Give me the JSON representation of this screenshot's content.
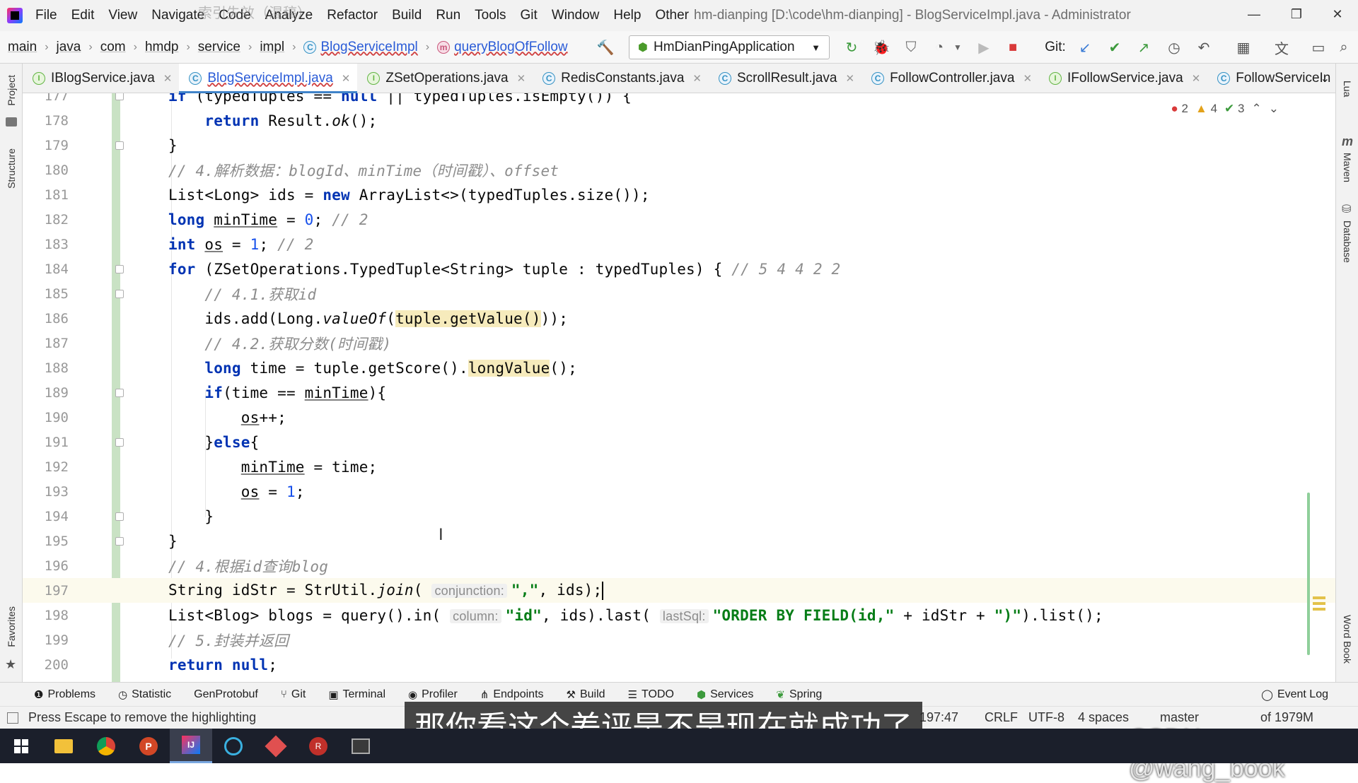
{
  "titlebar": {
    "menu": [
      "File",
      "Edit",
      "View",
      "Navigate",
      "Code",
      "Analyze",
      "Refactor",
      "Build",
      "Run",
      "Tools",
      "Git",
      "Window",
      "Help",
      "Other"
    ],
    "title": "hm-dianping [D:\\code\\hm-dianping] - BlogServiceImpl.java - Administrator",
    "watermark": "索引失效（混稿）"
  },
  "breadcrumb": [
    "main",
    "java",
    "com",
    "hmdp",
    "service",
    "impl",
    "BlogServiceImpl",
    "queryBlogOfFollow"
  ],
  "run_config": "HmDianPingApplication",
  "git_label": "Git:",
  "tabs": [
    {
      "name": "IBlogService.java",
      "kind": "I",
      "active": false
    },
    {
      "name": "BlogServiceImpl.java",
      "kind": "C",
      "active": true
    },
    {
      "name": "ZSetOperations.java",
      "kind": "I",
      "active": false
    },
    {
      "name": "RedisConstants.java",
      "kind": "C",
      "active": false
    },
    {
      "name": "ScrollResult.java",
      "kind": "C",
      "active": false
    },
    {
      "name": "FollowController.java",
      "kind": "C",
      "active": false
    },
    {
      "name": "IFollowService.java",
      "kind": "I",
      "active": false
    },
    {
      "name": "FollowServiceIn",
      "kind": "C",
      "active": false
    }
  ],
  "inspections": {
    "errors": "2",
    "warnings": "4",
    "weak": "3"
  },
  "left_tools": [
    "Project",
    "Structure",
    "Favorites"
  ],
  "right_tools": [
    "Lua",
    "Maven",
    "Database",
    "Word Book"
  ],
  "line_numbers": [
    "177",
    "178",
    "179",
    "180",
    "181",
    "182",
    "183",
    "184",
    "185",
    "186",
    "187",
    "188",
    "189",
    "190",
    "191",
    "192",
    "193",
    "194",
    "195",
    "196",
    "197",
    "198",
    "199",
    "200"
  ],
  "hints": {
    "conjunction": "conjunction:",
    "column": "column:",
    "lastSql": "lastSql:"
  },
  "tool_windows": [
    "Problems",
    "Statistic",
    "GenProtobuf",
    "Git",
    "Terminal",
    "Profiler",
    "Endpoints",
    "Build",
    "TODO",
    "Services",
    "Spring"
  ],
  "event_log": "Event Log",
  "status": {
    "message": "Press Escape to remove the highlighting",
    "position": "197:47",
    "line_sep": "CRLF",
    "encoding": "UTF-8",
    "indent": "4 spaces",
    "branch": "master",
    "memory": "of 1979M"
  },
  "subtitle": "那你看这个差评是不是现在就成功了",
  "watermark_csdn": "CSDN @wang_book",
  "colors": {
    "keyword": "#0033b3",
    "comment": "#8c8c8c",
    "string": "#067d17",
    "number": "#1750eb",
    "accent": "#4083c9"
  }
}
